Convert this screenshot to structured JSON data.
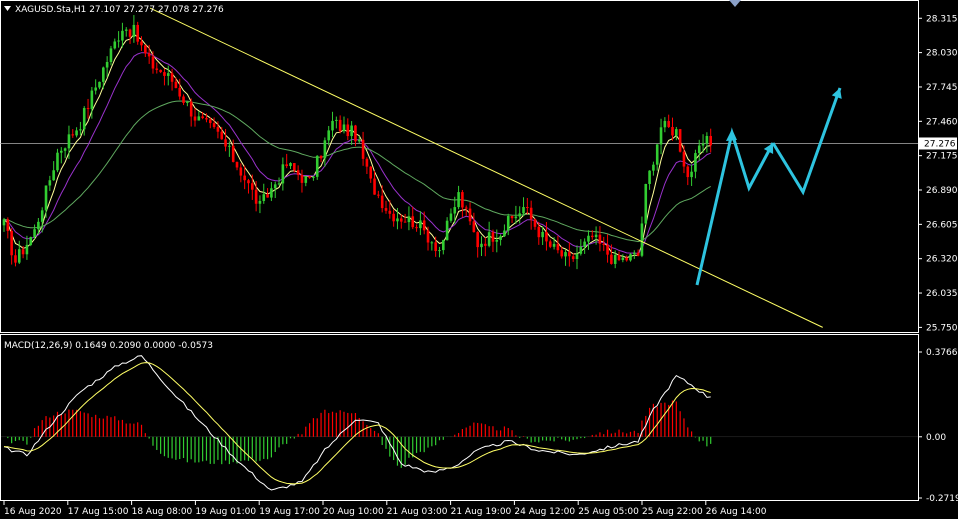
{
  "header": {
    "symbol_line": "XAGUSD.Sta,H1  27.107 27.277 27.078 27.276",
    "macd_line": "MACD(12,26,9) 0.1649 0.2090 0.0000 -0.0573"
  },
  "colors": {
    "background": "#000000",
    "frame": "#ffffff",
    "bull": "#32cd32",
    "bear": "#ff0000",
    "trendline": "#ffff66",
    "ma_fast": "#ffff99",
    "ma_mid": "#9932cc",
    "ma_slow": "#5fa85f",
    "arrow": "#2ec4e0",
    "macd_line": "#ffffff",
    "signal_line": "#ffff66"
  },
  "chart_data": [
    {
      "type": "candlestick",
      "title": "XAGUSD.Sta,H1",
      "y_ticks": [
        "28.315",
        "28.030",
        "27.745",
        "27.460",
        "27.175",
        "26.890",
        "26.605",
        "26.320",
        "26.035",
        "25.750"
      ],
      "ylim": [
        25.72,
        28.45
      ],
      "current_price": "27.276",
      "x_ticks": [
        "16 Aug 2020",
        "17 Aug 15:00",
        "18 Aug 08:00",
        "19 Aug 01:00",
        "19 Aug 17:00",
        "20 Aug 10:00",
        "21 Aug 03:00",
        "21 Aug 19:00",
        "24 Aug 12:00",
        "25 Aug 05:00",
        "25 Aug 22:00",
        "26 Aug 14:00"
      ],
      "trendline": [
        [
          0,
          28.4
        ],
        [
          196,
          25.75
        ]
      ],
      "key_prices": [
        {
          "i": 0,
          "p": 26.6
        },
        {
          "i": 3,
          "p": 26.3
        },
        {
          "i": 8,
          "p": 26.55
        },
        {
          "i": 14,
          "p": 27.2
        },
        {
          "i": 20,
          "p": 27.45
        },
        {
          "i": 26,
          "p": 27.9
        },
        {
          "i": 31,
          "p": 28.25
        },
        {
          "i": 34,
          "p": 28.2
        },
        {
          "i": 38,
          "p": 27.95
        },
        {
          "i": 44,
          "p": 27.8
        },
        {
          "i": 50,
          "p": 27.5
        },
        {
          "i": 56,
          "p": 27.35
        },
        {
          "i": 62,
          "p": 27.05
        },
        {
          "i": 67,
          "p": 26.75
        },
        {
          "i": 74,
          "p": 27.1
        },
        {
          "i": 80,
          "p": 26.95
        },
        {
          "i": 86,
          "p": 27.45
        },
        {
          "i": 92,
          "p": 27.35
        },
        {
          "i": 96,
          "p": 26.95
        },
        {
          "i": 101,
          "p": 26.7
        },
        {
          "i": 108,
          "p": 26.62
        },
        {
          "i": 114,
          "p": 26.4
        },
        {
          "i": 119,
          "p": 26.85
        },
        {
          "i": 124,
          "p": 26.45
        },
        {
          "i": 130,
          "p": 26.55
        },
        {
          "i": 136,
          "p": 26.75
        },
        {
          "i": 142,
          "p": 26.45
        },
        {
          "i": 148,
          "p": 26.3
        },
        {
          "i": 154,
          "p": 26.5
        },
        {
          "i": 160,
          "p": 26.3
        },
        {
          "i": 166,
          "p": 26.35
        },
        {
          "i": 168,
          "p": 26.9
        },
        {
          "i": 172,
          "p": 27.42
        },
        {
          "i": 176,
          "p": 27.38
        },
        {
          "i": 179,
          "p": 27.0
        },
        {
          "i": 183,
          "p": 27.28
        }
      ],
      "forecast_arrows": [
        [
          [
            697,
            285
          ],
          [
            732,
            133
          ],
          [
            749,
            188
          ],
          [
            773,
            143
          ]
        ],
        [
          [
            773,
            143
          ],
          [
            803,
            192
          ],
          [
            840,
            88
          ]
        ]
      ]
    },
    {
      "type": "macd",
      "title": "MACD(12,26,9)",
      "params": [
        12,
        26,
        9
      ],
      "y_ticks": [
        "0.3766",
        "0.00",
        "-0.2719"
      ],
      "ylim": [
        -0.2719,
        0.3766
      ],
      "macd_keys": [
        {
          "i": 0,
          "v": -0.05
        },
        {
          "i": 6,
          "v": -0.08
        },
        {
          "i": 12,
          "v": 0.05
        },
        {
          "i": 20,
          "v": 0.2
        },
        {
          "i": 30,
          "v": 0.32
        },
        {
          "i": 36,
          "v": 0.36
        },
        {
          "i": 44,
          "v": 0.2
        },
        {
          "i": 54,
          "v": 0.02
        },
        {
          "i": 62,
          "v": -0.12
        },
        {
          "i": 70,
          "v": -0.24
        },
        {
          "i": 78,
          "v": -0.2
        },
        {
          "i": 84,
          "v": -0.06
        },
        {
          "i": 92,
          "v": 0.08
        },
        {
          "i": 98,
          "v": 0.06
        },
        {
          "i": 104,
          "v": -0.12
        },
        {
          "i": 112,
          "v": -0.16
        },
        {
          "i": 118,
          "v": -0.13
        },
        {
          "i": 124,
          "v": -0.06
        },
        {
          "i": 132,
          "v": -0.02
        },
        {
          "i": 140,
          "v": -0.06
        },
        {
          "i": 150,
          "v": -0.08
        },
        {
          "i": 160,
          "v": -0.04
        },
        {
          "i": 166,
          "v": -0.02
        },
        {
          "i": 170,
          "v": 0.12
        },
        {
          "i": 176,
          "v": 0.27
        },
        {
          "i": 180,
          "v": 0.23
        },
        {
          "i": 184,
          "v": 0.18
        }
      ]
    }
  ]
}
